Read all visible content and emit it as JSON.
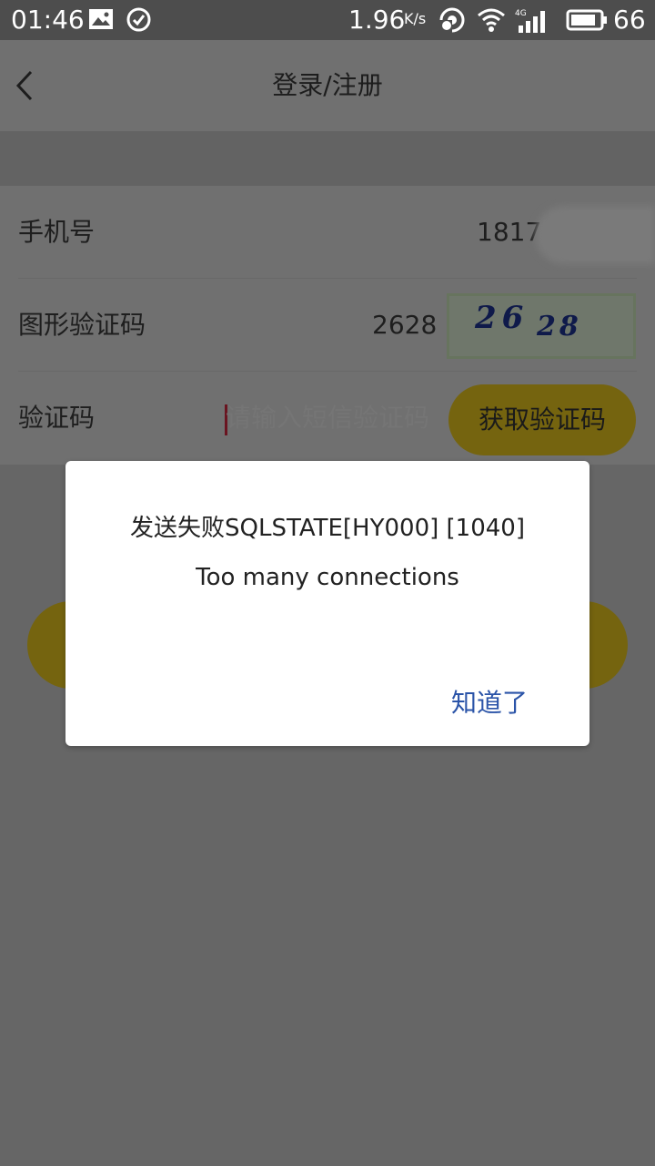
{
  "status_bar": {
    "time": "01:46",
    "net_speed": "1.96",
    "net_speed_unit": "K/s",
    "network_type": "4G",
    "battery": "66"
  },
  "header": {
    "title": "登录/注册"
  },
  "form": {
    "phone_label": "手机号",
    "phone_value": "1817",
    "captcha_label": "图形验证码",
    "captcha_value": "2628",
    "captcha_image_text_a": "26",
    "captcha_image_text_b": "28",
    "sms_label": "验证码",
    "sms_placeholder": "请输入短信验证码",
    "get_code_button": "获取验证码"
  },
  "dialog": {
    "message_line1": "发送失败SQLSTATE[HY000] [1040]",
    "message_line2": "Too many connections",
    "confirm_label": "知道了"
  },
  "colors": {
    "accent": "#f2c21f",
    "dialog_link": "#2b54a8",
    "overlay": "#666666"
  }
}
